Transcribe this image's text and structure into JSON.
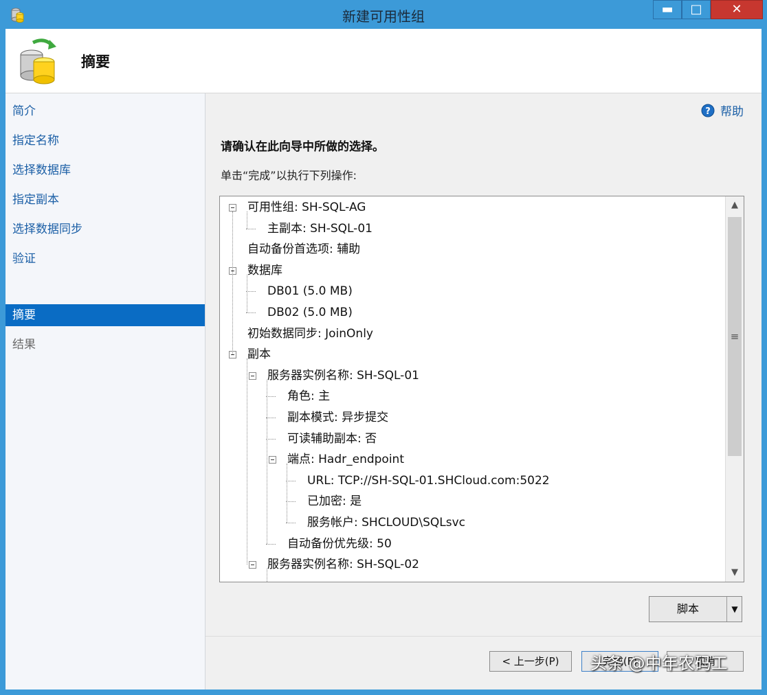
{
  "window": {
    "title": "新建可用性组",
    "controls": {
      "minimize": "▬",
      "maximize": "□",
      "close": "✕"
    }
  },
  "header": {
    "title": "摘要"
  },
  "sidebar": {
    "items": [
      {
        "label": "简介",
        "state": "normal"
      },
      {
        "label": "指定名称",
        "state": "normal"
      },
      {
        "label": "选择数据库",
        "state": "normal"
      },
      {
        "label": "指定副本",
        "state": "normal"
      },
      {
        "label": "选择数据同步",
        "state": "normal"
      },
      {
        "label": "验证",
        "state": "normal"
      },
      {
        "label": "摘要",
        "state": "active"
      },
      {
        "label": "结果",
        "state": "disabled"
      }
    ]
  },
  "main": {
    "help_label": "帮助",
    "intro": "请确认在此向导中所做的选择。",
    "instruction": "单击“完成”以执行下列操作:",
    "tree": [
      {
        "text": "可用性组: SH-SQL-AG",
        "level": 0,
        "expander": true
      },
      {
        "text": "主副本: SH-SQL-01",
        "level": 1,
        "expander": false
      },
      {
        "text": "自动备份首选项: 辅助",
        "level": 0,
        "expander": false
      },
      {
        "text": "数据库",
        "level": 0,
        "expander": true
      },
      {
        "text": "DB01 (5.0 MB)",
        "level": 1,
        "expander": false
      },
      {
        "text": "DB02 (5.0 MB)",
        "level": 1,
        "expander": false
      },
      {
        "text": "初始数据同步: JoinOnly",
        "level": 0,
        "expander": false
      },
      {
        "text": "副本",
        "level": 0,
        "expander": true
      },
      {
        "text": "服务器实例名称: SH-SQL-01",
        "level": 1,
        "expander": true
      },
      {
        "text": "角色: 主",
        "level": 2,
        "expander": false
      },
      {
        "text": "副本模式: 异步提交",
        "level": 2,
        "expander": false
      },
      {
        "text": "可读辅助副本: 否",
        "level": 2,
        "expander": false
      },
      {
        "text": "端点: Hadr_endpoint",
        "level": 2,
        "expander": true
      },
      {
        "text": "URL: TCP://SH-SQL-01.SHCloud.com:5022",
        "level": 3,
        "expander": false
      },
      {
        "text": "已加密: 是",
        "level": 3,
        "expander": false
      },
      {
        "text": "服务帐户: SHCLOUD\\SQLsvc",
        "level": 3,
        "expander": false
      },
      {
        "text": "自动备份优先级: 50",
        "level": 2,
        "expander": false
      },
      {
        "text": "服务器实例名称: SH-SQL-02",
        "level": 1,
        "expander": true
      }
    ],
    "scroll": {
      "up": "▲",
      "down": "▼",
      "grip": "≡"
    },
    "script_button": {
      "label": "脚本",
      "arrow": "▼"
    }
  },
  "footer": {
    "prev_label": "< 上一步(P)",
    "finish_label": "完成(F)",
    "cancel_label": "取消"
  },
  "watermark": "头条 @中年农码工"
}
